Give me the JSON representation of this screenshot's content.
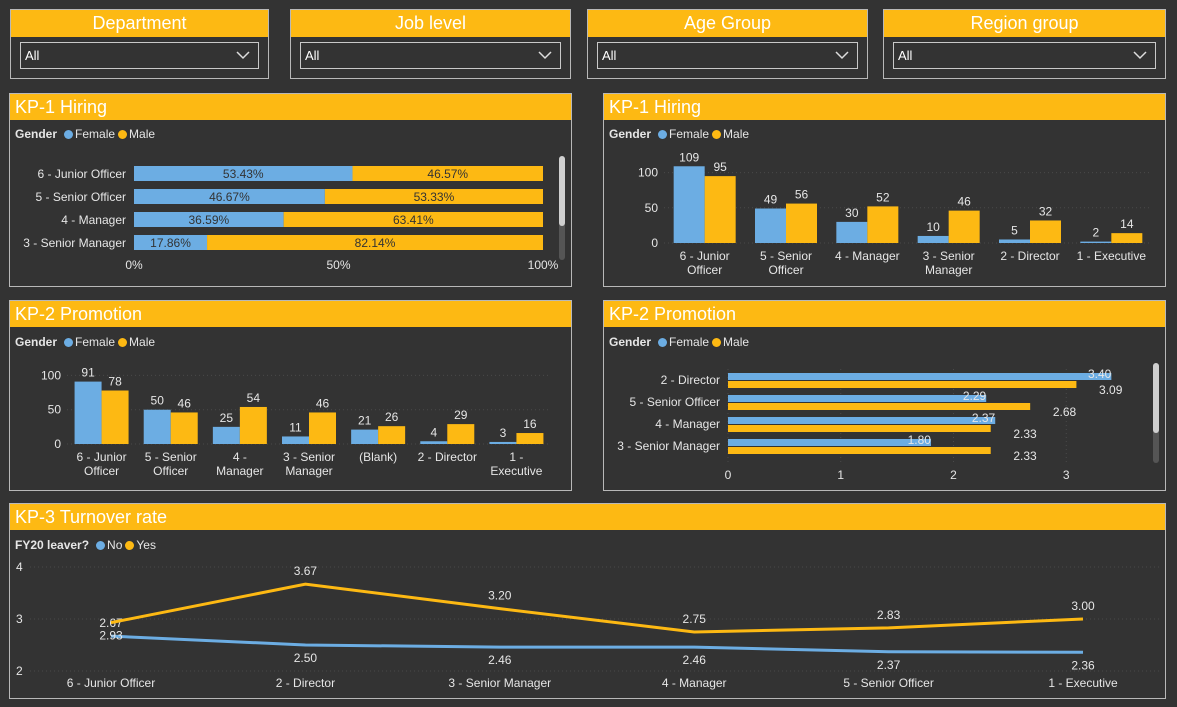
{
  "colors": {
    "female": "#6cade3",
    "male": "#fdb913",
    "no": "#6cade3",
    "yes": "#fdb913",
    "header": "#fdb913",
    "background": "#333333"
  },
  "slicers": [
    {
      "title": "Department",
      "value": "All"
    },
    {
      "title": "Job level",
      "value": "All"
    },
    {
      "title": "Age Group",
      "value": "All"
    },
    {
      "title": "Region group",
      "value": "All"
    }
  ],
  "panels": {
    "hiring_pct": {
      "title": "KP-1 Hiring",
      "legend_title": "Gender",
      "legend": [
        "Female",
        "Male"
      ]
    },
    "hiring_count": {
      "title": "KP-1 Hiring",
      "legend_title": "Gender",
      "legend": [
        "Female",
        "Male"
      ]
    },
    "promo_count": {
      "title": "KP-2 Promotion",
      "legend_title": "Gender",
      "legend": [
        "Female",
        "Male"
      ]
    },
    "promo_avg": {
      "title": "KP-2 Promotion",
      "legend_title": "Gender",
      "legend": [
        "Female",
        "Male"
      ]
    },
    "turnover": {
      "title": "KP-3 Turnover rate",
      "legend_title": "FY20 leaver?",
      "legend": [
        "No",
        "Yes"
      ]
    }
  },
  "chart_data": [
    {
      "id": "hiring_pct",
      "type": "bar",
      "orientation": "horizontal",
      "stacked": "100%",
      "categories": [
        "6 - Junior Officer",
        "5 - Senior Officer",
        "4 - Manager",
        "3 - Senior Manager"
      ],
      "series": [
        {
          "name": "Female",
          "values": [
            53.43,
            46.67,
            36.59,
            17.86
          ],
          "labels": [
            "53.43%",
            "46.67%",
            "36.59%",
            "17.86%"
          ]
        },
        {
          "name": "Male",
          "values": [
            46.57,
            53.33,
            63.41,
            82.14
          ],
          "labels": [
            "46.57%",
            "53.33%",
            "63.41%",
            "82.14%"
          ]
        }
      ],
      "xticks": [
        "0%",
        "50%",
        "100%"
      ],
      "xlim": [
        0,
        100
      ]
    },
    {
      "id": "hiring_count",
      "type": "bar",
      "orientation": "vertical",
      "categories": [
        [
          "6 - Junior",
          "Officer"
        ],
        [
          "5 - Senior",
          "Officer"
        ],
        [
          "4 - Manager"
        ],
        [
          "3 - Senior",
          "Manager"
        ],
        [
          "2 - Director"
        ],
        [
          "1 - Executive"
        ]
      ],
      "series": [
        {
          "name": "Female",
          "values": [
            109,
            49,
            30,
            10,
            5,
            2
          ]
        },
        {
          "name": "Male",
          "values": [
            95,
            56,
            52,
            46,
            32,
            14
          ]
        }
      ],
      "yticks": [
        0,
        50,
        100
      ],
      "ylim": [
        0,
        125
      ]
    },
    {
      "id": "promo_count",
      "type": "bar",
      "orientation": "vertical",
      "categories": [
        [
          "6 - Junior",
          "Officer"
        ],
        [
          "5 - Senior",
          "Officer"
        ],
        [
          "4 -",
          "Manager"
        ],
        [
          "3 - Senior",
          "Manager"
        ],
        [
          "(Blank)"
        ],
        [
          "2 - Director"
        ],
        [
          "1 -",
          "Executive"
        ]
      ],
      "series": [
        {
          "name": "Female",
          "values": [
            91,
            50,
            25,
            11,
            21,
            4,
            3
          ]
        },
        {
          "name": "Male",
          "values": [
            78,
            46,
            54,
            46,
            26,
            29,
            16
          ]
        }
      ],
      "yticks": [
        0,
        50,
        100
      ],
      "ylim": [
        0,
        105
      ]
    },
    {
      "id": "promo_avg",
      "type": "bar",
      "orientation": "horizontal",
      "categories": [
        "2 - Director",
        "5 - Senior Officer",
        "4 - Manager",
        "3 - Senior Manager"
      ],
      "series": [
        {
          "name": "Female",
          "values": [
            3.4,
            2.29,
            2.37,
            1.8
          ],
          "labels": [
            "3.40",
            "2.29",
            "2.37",
            "1.80"
          ]
        },
        {
          "name": "Male",
          "values": [
            3.09,
            2.68,
            2.33,
            2.33
          ],
          "labels": [
            "3.09",
            "2.68",
            "2.33",
            "2.33"
          ]
        }
      ],
      "xticks": [
        0,
        1,
        2,
        3
      ],
      "xlim": [
        0,
        3.45
      ]
    },
    {
      "id": "turnover",
      "type": "line",
      "categories": [
        "6 - Junior Officer",
        "2 - Director",
        "3 - Senior Manager",
        "4 - Manager",
        "5 - Senior Officer",
        "1 - Executive"
      ],
      "series": [
        {
          "name": "No",
          "values": [
            2.67,
            2.5,
            2.46,
            2.46,
            2.37,
            2.36
          ],
          "labels": [
            "2.67",
            "2.50",
            "2.46",
            "2.46",
            "2.37",
            "2.36"
          ]
        },
        {
          "name": "Yes",
          "values": [
            2.93,
            3.67,
            3.2,
            2.75,
            2.83,
            3.0
          ],
          "labels": [
            "2.93",
            "3.67",
            "3.20",
            "2.75",
            "2.83",
            "3.00"
          ]
        }
      ],
      "yticks": [
        2,
        3,
        4
      ],
      "ylim": [
        2,
        4
      ]
    }
  ]
}
